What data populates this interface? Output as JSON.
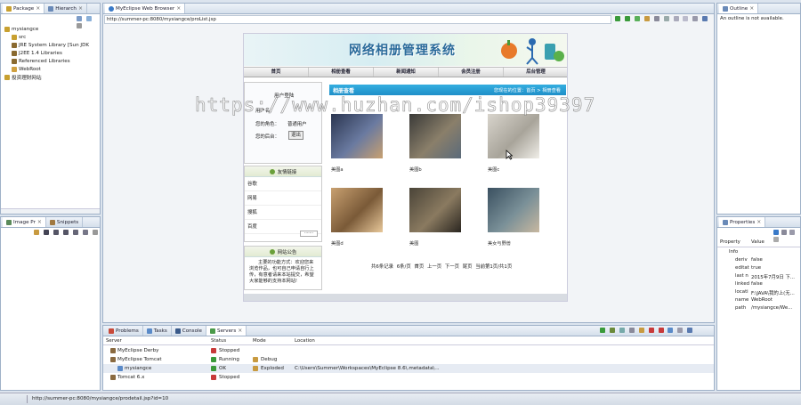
{
  "package_explorer": {
    "tabs": [
      "Package",
      "Hierarch"
    ],
    "tree": [
      {
        "label": "mysiangce",
        "indent": 0,
        "color": "#c8a030"
      },
      {
        "label": "src",
        "indent": 1,
        "color": "#c8a030"
      },
      {
        "label": "JRE System Library [Sun JDK",
        "indent": 1,
        "color": "#8a6a30"
      },
      {
        "label": "J2EE 1.4 Libraries",
        "indent": 1,
        "color": "#8a6a30"
      },
      {
        "label": "Referenced Libraries",
        "indent": 1,
        "color": "#8a6a30"
      },
      {
        "label": "WebRoot",
        "indent": 1,
        "color": "#d0a040"
      },
      {
        "label": "投资理财网站",
        "indent": 0,
        "color": "#c8a030"
      }
    ]
  },
  "image_panel": {
    "tabs": [
      "Image Pr",
      "Snippets"
    ]
  },
  "browser": {
    "tab_title": "MyEclipse Web Browser",
    "url": "http://summer-pc:8080/mysiangce/proList.jsp"
  },
  "webpage": {
    "banner_title": "网络相册管理系统",
    "nav": [
      "首页",
      "相册查看",
      "新闻通知",
      "会员注册",
      "后台管理"
    ],
    "user_box": {
      "title": "用户登陆",
      "username_label": "用户名：",
      "role_label": "您的角色：",
      "role_value": "普通用户",
      "action_label": "您的后台：",
      "exit_button": "退出"
    },
    "links": {
      "title": "友情链接",
      "items": [
        "谷歌",
        "网易",
        "搜狐",
        "百度"
      ],
      "select_value": "·······"
    },
    "notice": {
      "title": "网站公告",
      "text": "主要的功能方式：欢迎您来浏览作品，也可自己申请自行上传，有意者请来本站提交，希望大家能够的支持本网站!"
    },
    "album": {
      "title": "相册查看",
      "breadcrumb": "您现在的位置：首页 > 相册查看",
      "photos": [
        {
          "caption": "美图a",
          "colors": [
            "#2a3550",
            "#6a7aa0",
            "#c8a070"
          ]
        },
        {
          "caption": "美图b",
          "colors": [
            "#3a3a38",
            "#8a7f6a",
            "#5a6a7a"
          ]
        },
        {
          "caption": "美图c",
          "colors": [
            "#d8d4cc",
            "#a8a49a",
            "#f0eee8"
          ]
        },
        {
          "caption": "美图d",
          "colors": [
            "#c8a070",
            "#7a5a38",
            "#e8c89a"
          ]
        },
        {
          "caption": "美图",
          "colors": [
            "#4a4438",
            "#8a7a60",
            "#2a2620"
          ]
        },
        {
          "caption": "美女与野兽",
          "colors": [
            "#3a5060",
            "#7a9098",
            "#c8b8a0"
          ]
        }
      ],
      "pagination": "共6条记录 6条/页 首页 上一页 下一页 尾页 当前第1页/共1页"
    }
  },
  "watermark": "https://www.huzhan.com/ishop39397",
  "outline": {
    "tab": "Outline",
    "message": "An outline is not available."
  },
  "properties": {
    "tab": "Properties",
    "headers": [
      "Property",
      "Value"
    ],
    "group": "Info",
    "rows": [
      {
        "key": "deriv",
        "value": "false"
      },
      {
        "key": "editat",
        "value": "true"
      },
      {
        "key": "last n",
        "value": "2015年7月9日 下..."
      },
      {
        "key": "linked",
        "value": "false"
      },
      {
        "key": "locati",
        "value": "F:\\JAVA\\我的上(无..."
      },
      {
        "key": "name",
        "value": "WebRoot"
      },
      {
        "key": "path",
        "value": "/mysiangce/We..."
      }
    ]
  },
  "servers": {
    "tabs": [
      "Problems",
      "Tasks",
      "Console",
      "Servers"
    ],
    "headers": [
      "Server",
      "Status",
      "Mode",
      "Location"
    ],
    "rows": [
      {
        "server": "MyEclipse Derby",
        "status": "Stopped",
        "mode": "",
        "location": "",
        "indent": 1
      },
      {
        "server": "MyEclipse Tomcat",
        "status": "Running",
        "mode": "Debug",
        "location": "",
        "indent": 1
      },
      {
        "server": "mysiangce",
        "status": "OK",
        "mode": "Exploded",
        "location": "C:\\Users\\Summer\\Workspaces\\MyEclipse 8.6\\.metadata\\...",
        "indent": 2
      },
      {
        "server": "Tomcat  6.x",
        "status": "Stopped",
        "mode": "",
        "location": "",
        "indent": 1
      }
    ]
  },
  "status_bar": {
    "text": "http://summer-pc:8080/mysiangce/prodetail.jsp?id=10"
  }
}
